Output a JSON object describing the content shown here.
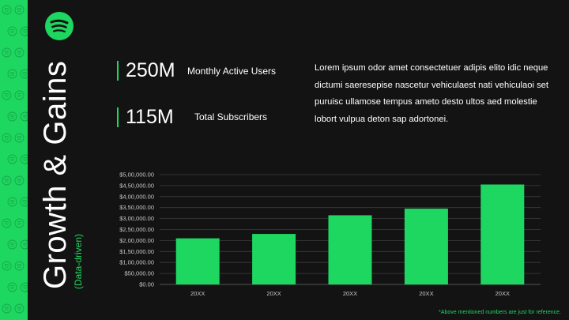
{
  "slide": {
    "title": "Growth & Gains",
    "subtitle": "(Data-driven)",
    "logo_icon": "spotify-logo-icon",
    "accent_color": "#1ed760",
    "background_color": "#131313"
  },
  "stats": [
    {
      "value": "250M",
      "label": "Monthly Active Users"
    },
    {
      "value": "115M",
      "label": "Total Subscribers"
    }
  ],
  "paragraph": "Lorem ipsum odor amet consectetuer adipis elito idic neque dictumi saeresepise nascetur vehiculaest nati vehiculaoi set puruisc ullamose tempus ameto desto ultos aed molestie lobort vulpua deton sap adortonei.",
  "footnote": "*Above mentioned numbers are just for reference.",
  "chart_data": {
    "type": "bar",
    "categories": [
      "20XX",
      "20XX",
      "20XX",
      "20XX",
      "20XX"
    ],
    "values": [
      2100000,
      2300000,
      3150000,
      3450000,
      4550000
    ],
    "ylim": [
      0,
      5000000
    ],
    "yticks": [
      "$0.00",
      "$50,000.00",
      "$1,00,000.00",
      "$1,50,000.00",
      "$2,00,000.00",
      "$2,50,000.00",
      "$3,00,000.00",
      "$3,50,000.00",
      "$4,00,000.00",
      "$4,50,000.00",
      "$5,00,000.00"
    ],
    "grid": true,
    "bar_color": "#1ed760",
    "title": "",
    "xlabel": "",
    "ylabel": ""
  }
}
